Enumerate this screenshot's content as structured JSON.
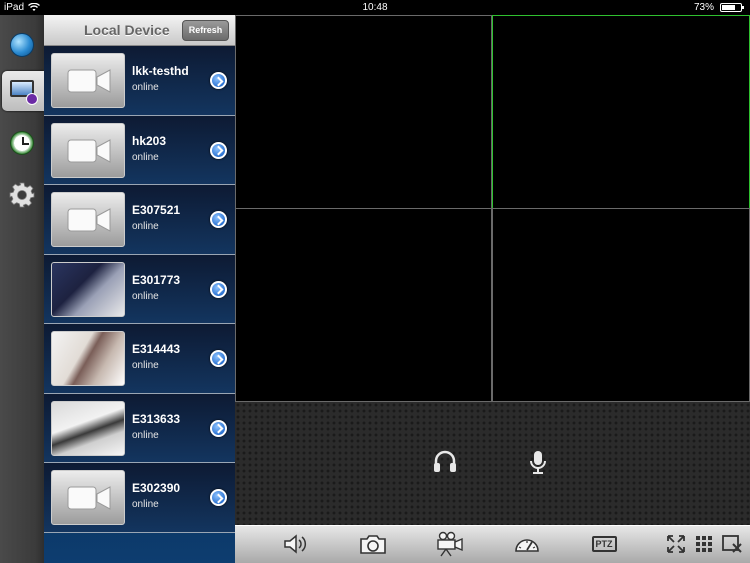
{
  "status_bar": {
    "carrier": "iPad",
    "time": "10:48",
    "battery_percent": "73%",
    "battery_level": 0.73
  },
  "nav_rail": {
    "items": [
      {
        "icon": "globe-icon",
        "active": false
      },
      {
        "icon": "device-list-icon",
        "active": true
      },
      {
        "icon": "clock-icon",
        "active": false
      },
      {
        "icon": "gear-icon",
        "active": false
      }
    ]
  },
  "device_panel": {
    "title": "Local Device",
    "refresh_label": "Refresh",
    "devices": [
      {
        "name": "lkk-testhd",
        "status": "online",
        "thumbnail": "camera-placeholder-icon"
      },
      {
        "name": "hk203",
        "status": "online",
        "thumbnail": "camera-placeholder-icon"
      },
      {
        "name": "E307521",
        "status": "online",
        "thumbnail": "camera-placeholder-icon"
      },
      {
        "name": "E301773",
        "status": "online",
        "thumbnail": "snapshot"
      },
      {
        "name": "E314443",
        "status": "online",
        "thumbnail": "snapshot"
      },
      {
        "name": "E313633",
        "status": "online",
        "thumbnail": "snapshot"
      },
      {
        "name": "E302390",
        "status": "online",
        "thumbnail": "camera-placeholder-icon"
      }
    ]
  },
  "video_grid": {
    "layout": "2x2",
    "selected_cell": 2
  },
  "audio_controls": {
    "icons": [
      "headphones-icon",
      "microphone-icon"
    ]
  },
  "toolbar": {
    "icons": [
      "speaker-icon",
      "camera-icon",
      "video-record-icon",
      "speedometer-icon",
      "ptz-icon",
      "fullscreen-icon",
      "grid-layout-icon",
      "close-window-icon"
    ],
    "ptz_label": "PTZ"
  },
  "colors": {
    "selected_cell_border": "#2fc02f",
    "cell_border": "#6a6a6a",
    "disclosure_blue": "#2c73d2"
  }
}
